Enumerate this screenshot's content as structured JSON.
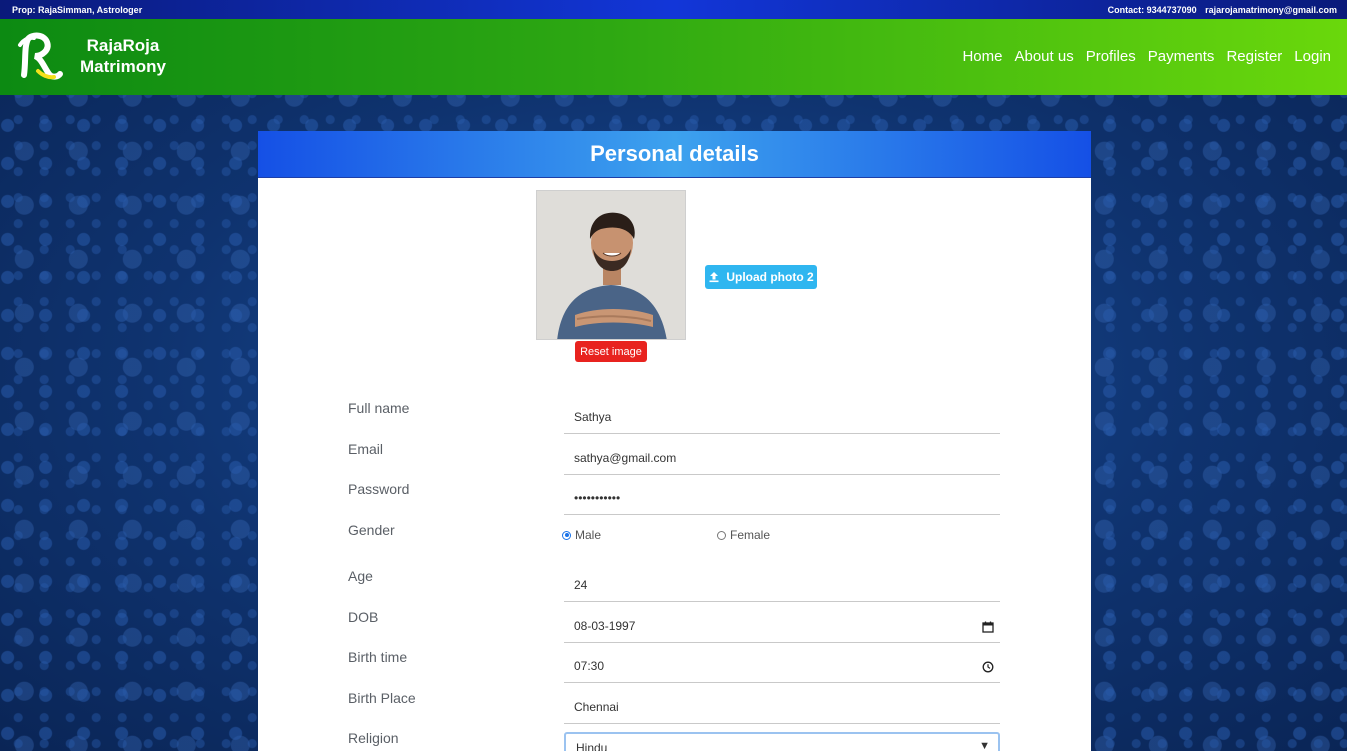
{
  "topbar": {
    "prop": "Prop: RajaSimman, Astrologer",
    "contact_label": "Contact: 9344737090",
    "email": "rajarojamatrimony@gmail.com"
  },
  "brand": {
    "line1": "RajaRoja",
    "line2": "Matrimony"
  },
  "nav": [
    "Home",
    "About us",
    "Profiles",
    "Payments",
    "Register",
    "Login"
  ],
  "card": {
    "title": "Personal details",
    "reset_label": "Reset image",
    "upload_label": "Upload photo 2"
  },
  "form": {
    "full_name": {
      "label": "Full name",
      "value": "Sathya"
    },
    "email": {
      "label": "Email",
      "value": "sathya@gmail.com"
    },
    "password": {
      "label": "Password",
      "value": "•••••••••••"
    },
    "gender": {
      "label": "Gender",
      "options": [
        "Male",
        "Female"
      ],
      "selected": "Male"
    },
    "age": {
      "label": "Age",
      "value": "24"
    },
    "dob": {
      "label": "DOB",
      "value": "08-03-1997"
    },
    "birth_time": {
      "label": "Birth time",
      "value": "07:30"
    },
    "birth_place": {
      "label": "Birth Place",
      "value": "Chennai"
    },
    "religion": {
      "label": "Religion",
      "value": "Hindu"
    }
  },
  "icons": {
    "calendar": "calendar-icon",
    "clock": "clock-icon",
    "upload": "upload-icon",
    "dropdown": "chevron-down-icon"
  },
  "colors": {
    "topbar": "#1236d8",
    "header_start": "#0c8a12",
    "header_end": "#6ad80c",
    "card_header": "#1550e6",
    "reset": "#e8231f",
    "upload": "#2fb6f0"
  }
}
